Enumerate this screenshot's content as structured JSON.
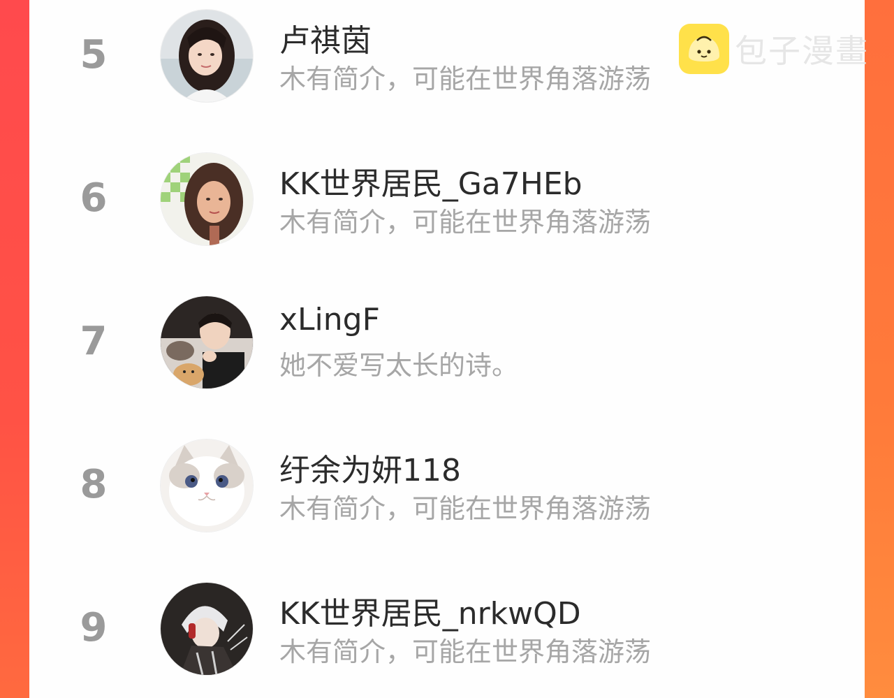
{
  "watermark": {
    "text": "包子漫畫",
    "logo_icon": "bun-face-icon",
    "logo_color": "#ffe14a"
  },
  "colors": {
    "frame_red": "#ff4f4a",
    "frame_orange": "#ff8a40",
    "rank_gray": "#9a9a9a",
    "name_color": "#2b2b2b",
    "bio_color": "#a6a6a6"
  },
  "users": [
    {
      "rank": "5",
      "name": "卢祺茵",
      "bio": "木有简介，可能在世界角落游荡",
      "avatar": "avatar-girl-long-hair"
    },
    {
      "rank": "6",
      "name": "KK世界居民_Ga7HEb",
      "bio": "木有简介，可能在世界角落游荡",
      "avatar": "avatar-girl-checkered"
    },
    {
      "rank": "7",
      "name": "xLingF",
      "bio": "她不爱写太长的诗。",
      "avatar": "avatar-man-with-cats"
    },
    {
      "rank": "8",
      "name": "纡余为妍118",
      "bio": "木有简介，可能在世界角落游荡",
      "avatar": "avatar-ragdoll-cat"
    },
    {
      "rank": "9",
      "name": "KK世界居民_nrkwQD",
      "bio": "木有简介，可能在世界角落游荡",
      "avatar": "avatar-anime-boy"
    }
  ]
}
